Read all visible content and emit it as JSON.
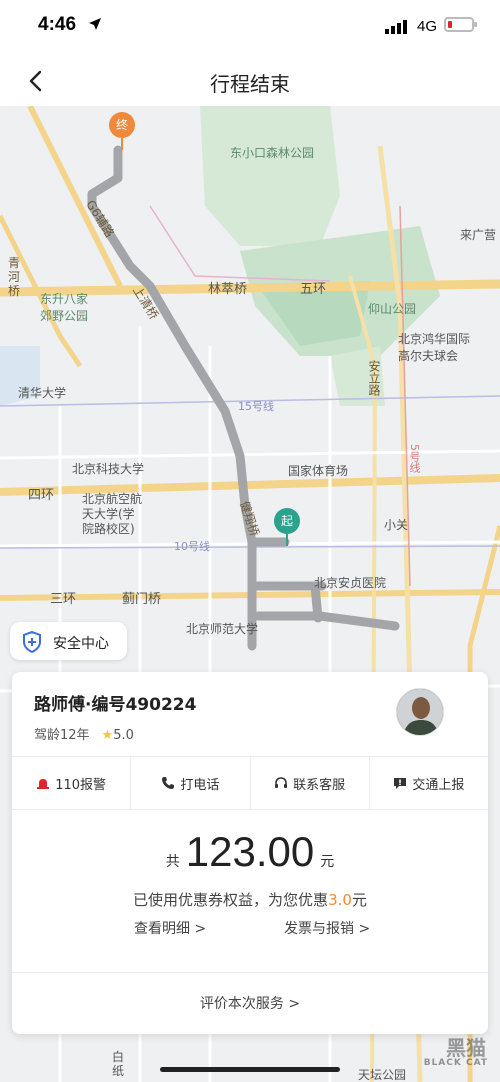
{
  "status": {
    "time": "4:46",
    "network": "4G",
    "battery_level": 0.1
  },
  "nav": {
    "title": "行程结束"
  },
  "map": {
    "labels": {
      "forest_park": "东小口森林公园",
      "lincui_bridge": "林萃桥",
      "fifth_ring": "五环",
      "yangshan_park": "仰山公园",
      "dongsheng_park": "东升八家\n郊野公园",
      "honghua_golf": "北京鸿华国际\n高尔夫球会",
      "tsinghua": "清华大学",
      "ustb": "北京科技大学",
      "national_stadium": "国家体育场",
      "fourth_ring": "四环",
      "buaa": "北京航空航\n天大学(学\n院路校区)",
      "xiaoguan": "小关",
      "anzhen": "北京安贞医院",
      "third_ring": "三环",
      "jimen_bridge": "蓟门桥",
      "bnu": "北京师范大学",
      "line15": "15号线",
      "line10": "10号线",
      "line5": "5号线",
      "g6": "G6辅路",
      "shangqing": "上清桥",
      "jianxiang": "健翔桥",
      "anli": "安立路",
      "qingheqiao": "青\n河\n桥",
      "laiguangying": "来广营",
      "tiantan": "天坛公园",
      "baizhi": "白\n纸"
    },
    "pins": {
      "end": "终",
      "start": "起"
    }
  },
  "safety": {
    "label": "安全中心"
  },
  "driver": {
    "name": "路师傅·编号490224",
    "years": "驾龄12年",
    "rating": "5.0"
  },
  "actions": [
    {
      "label": "110报警"
    },
    {
      "label": "打电话"
    },
    {
      "label": "联系客服"
    },
    {
      "label": "交通上报"
    }
  ],
  "fare": {
    "prefix": "共",
    "amount": "123.00",
    "unit": "元",
    "coupon_pre": "已使用优惠券权益，为您优惠",
    "coupon_value": "3.0",
    "coupon_post": "元",
    "details_link": "查看明细 >",
    "invoice_link": "发票与报销 >",
    "rate_link": "评价本次服务 >"
  },
  "watermark": {
    "title": "黑猫",
    "sub": "BLACK CAT"
  },
  "colors": {
    "accent": "#f08a3a",
    "start": "#2aa28c",
    "end": "#ef8a3c",
    "alarm": "#e0242f",
    "star": "#f6c343"
  }
}
